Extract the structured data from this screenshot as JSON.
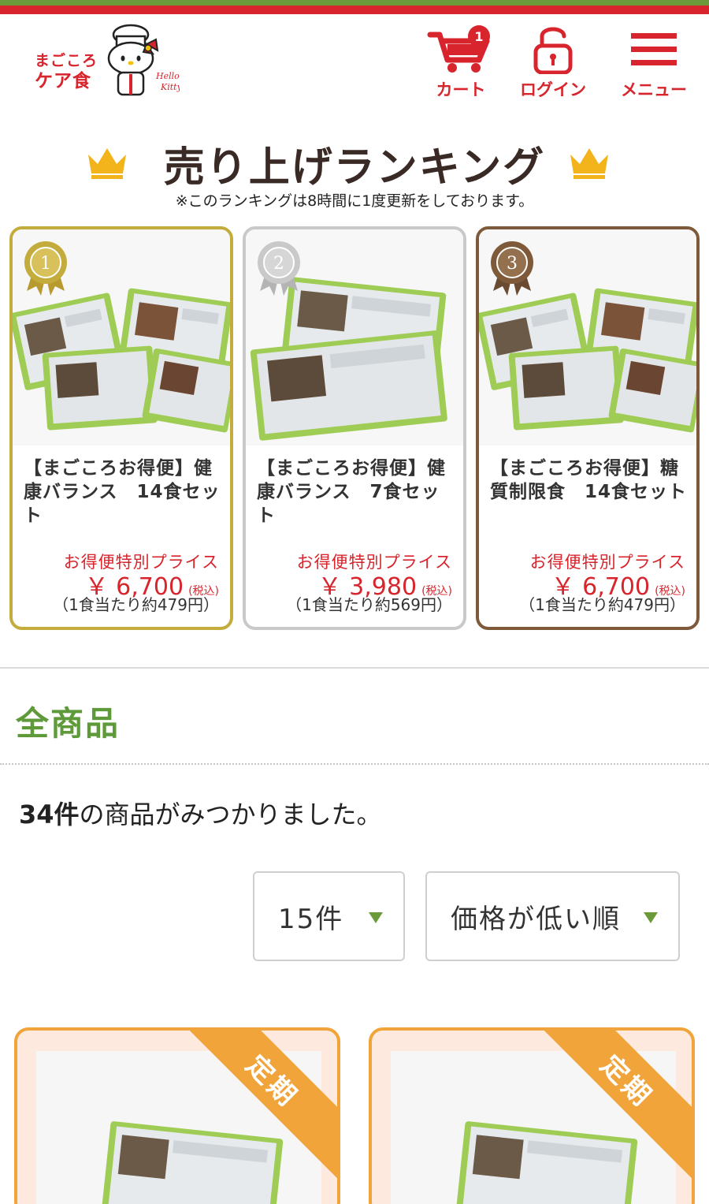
{
  "header": {
    "logo_line1": "まごころ",
    "logo_line2": "ケア食",
    "cart_label": "カート",
    "cart_count": "1",
    "login_label": "ログイン",
    "menu_label": "メニュー"
  },
  "ranking": {
    "title": "売り上げランキング",
    "note": "※このランキングは8時間に1度更新をしております。",
    "items": [
      {
        "rank": "1",
        "name": "【まごころお得便】健康バランス　14食セット",
        "price_label": "お得便特別プライス",
        "price": "￥ 6,700",
        "tax": "(税込)",
        "per_meal": "（1食当たり約479円）"
      },
      {
        "rank": "2",
        "name": "【まごころお得便】健康バランス　7食セット",
        "price_label": "お得便特別プライス",
        "price": "￥ 3,980",
        "tax": "(税込)",
        "per_meal": "（1食当たり約569円）"
      },
      {
        "rank": "3",
        "name": "【まごころお得便】糖質制限食　14食セット",
        "price_label": "お得便特別プライス",
        "price": "￥ 6,700",
        "tax": "(税込)",
        "per_meal": "（1食当たり約479円）"
      }
    ]
  },
  "products": {
    "section_title": "全商品",
    "count_number": "34件",
    "count_suffix": "の商品がみつかりました。",
    "per_page_select": "15件",
    "sort_select": "価格が低い順",
    "cards": [
      {
        "badge": "定期"
      },
      {
        "badge": "定期"
      }
    ]
  },
  "colors": {
    "brand_red": "#d8242c",
    "brand_green": "#6b9a3a",
    "gold": "#c4ac3c",
    "silver": "#c9c9c9",
    "bronze": "#7f5a3a",
    "orange": "#f0a43a"
  }
}
